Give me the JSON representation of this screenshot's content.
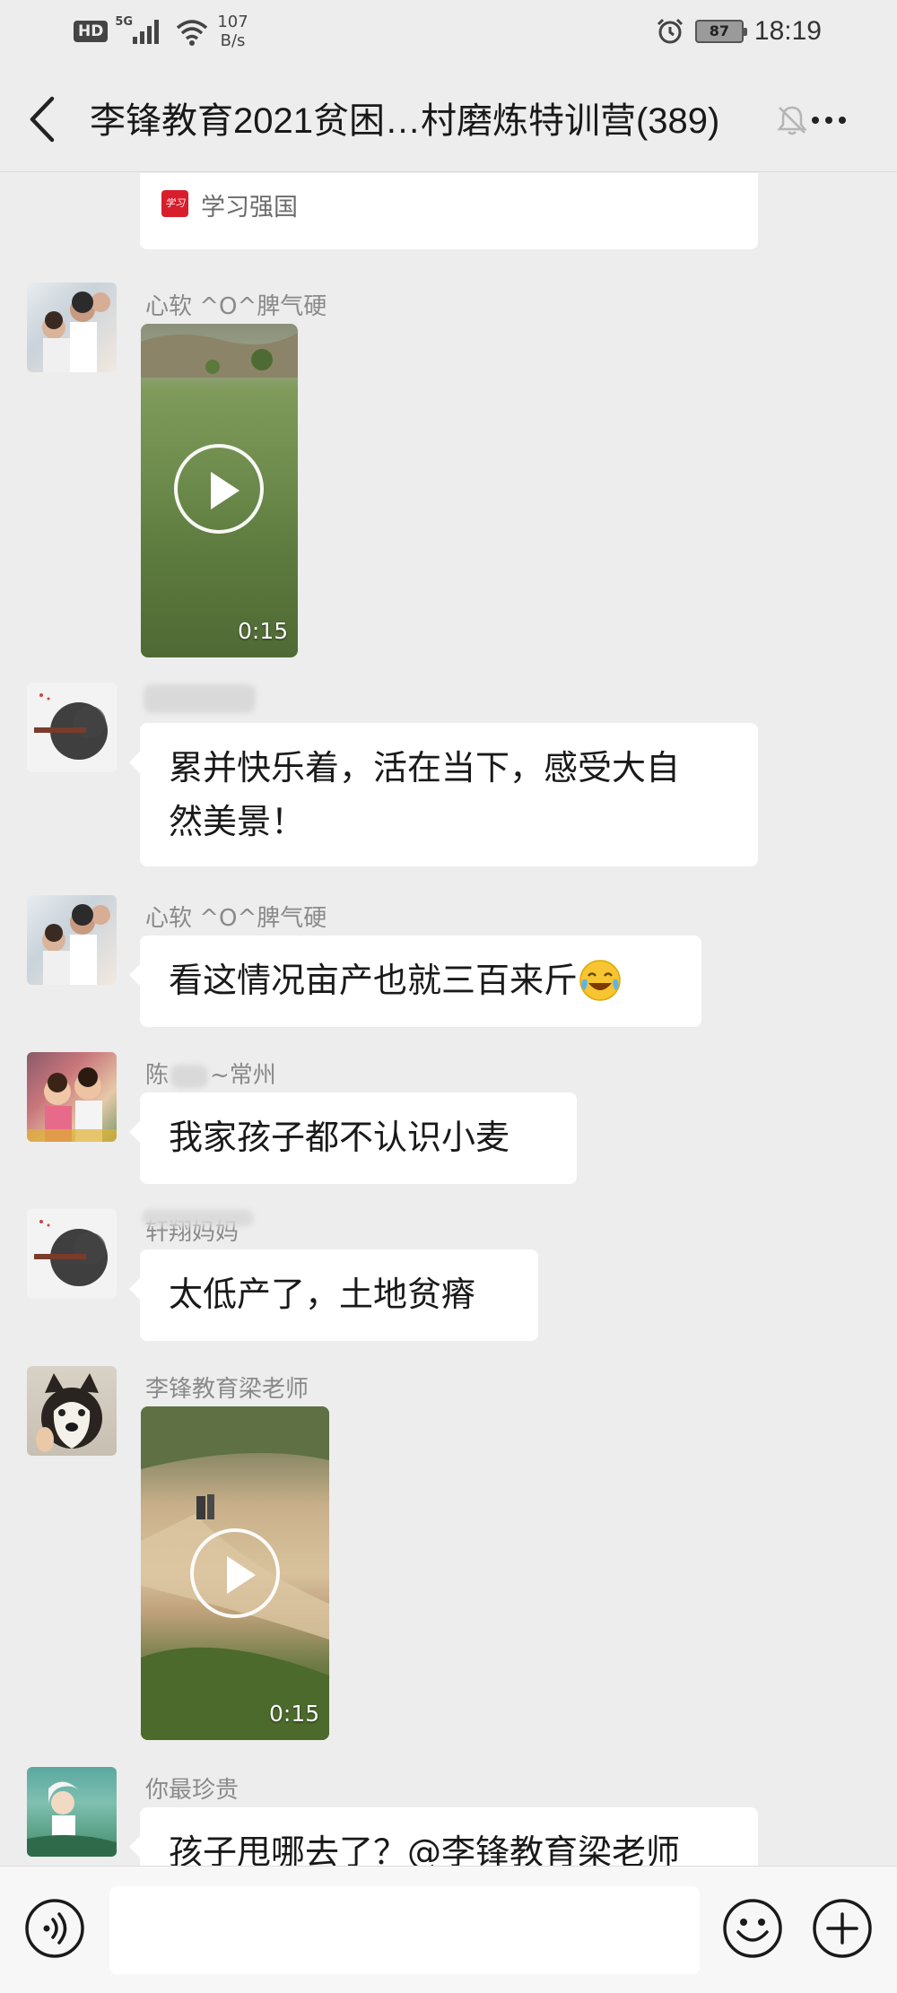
{
  "status_bar": {
    "hd": "HD",
    "network": "5G",
    "net_speed_value": "107",
    "net_speed_unit": "B/s",
    "battery": "87",
    "time": "18:19"
  },
  "header": {
    "title": "李锋教育2021贫困…村磨炼特训营(389)"
  },
  "messages": {
    "shared_card": {
      "source": "学习强国"
    },
    "m1": {
      "sender": "心软 ^O^脾气硬",
      "video_duration": "0:15"
    },
    "m2": {
      "sender": "",
      "text_line1": "累并快乐着，活在当下，感受大自",
      "text_line2": "然美景！"
    },
    "m3": {
      "sender": "心软 ^O^脾气硬",
      "text": "看这情况亩产也就三百来斤"
    },
    "m4": {
      "sender_prefix": "陈",
      "sender_suffix": "~常州",
      "text": "我家孩子都不认识小麦"
    },
    "m5": {
      "sender": "轩翔妈妈",
      "text": "太低产了，土地贫瘠"
    },
    "m6": {
      "sender": "李锋教育梁老师",
      "video_duration": "0:15"
    },
    "m7": {
      "sender": "你最珍贵",
      "text": "孩子甩哪去了？@李锋教育梁老师"
    }
  },
  "input_bar": {
    "placeholder": "",
    "icons": [
      "voice-icon",
      "emoji-icon",
      "plus-icon"
    ]
  },
  "colors": {
    "background": "#ededed",
    "bubble": "#ffffff",
    "sender_name": "#8a8a8a",
    "brand_red": "#d81e2b"
  }
}
